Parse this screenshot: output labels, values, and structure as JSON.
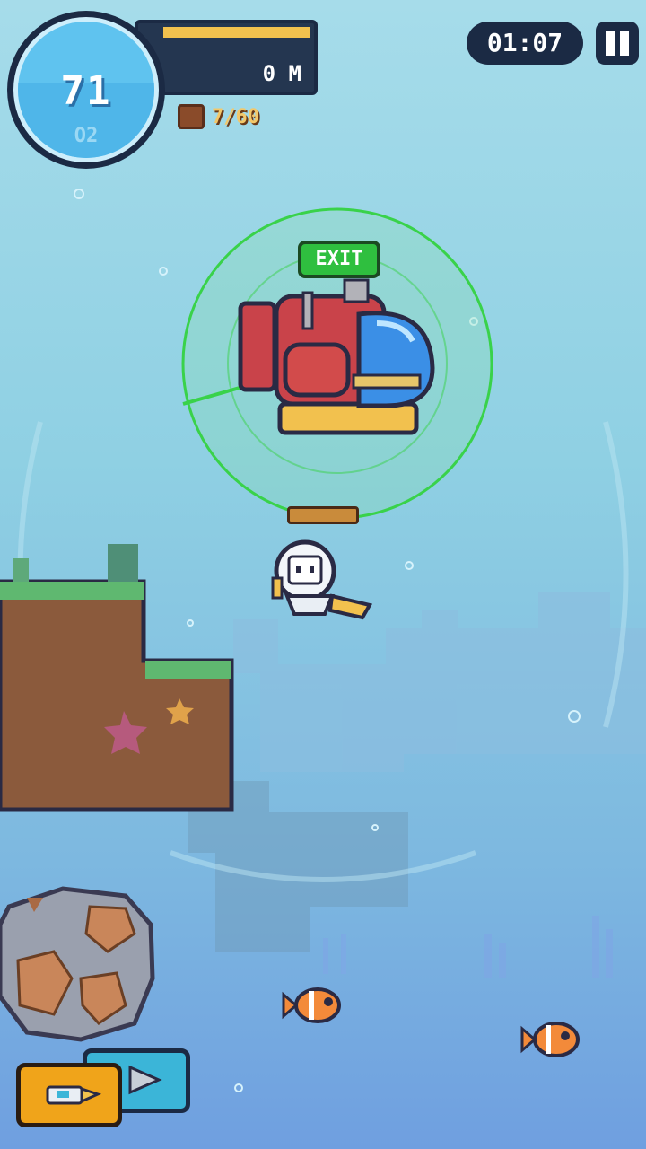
{
  "hud": {
    "oxygen_value": "71",
    "oxygen_label": "O2",
    "oxygen_level": 0.55,
    "depth": "0 M",
    "bag_count": "7/60",
    "timer": "01:07"
  },
  "submarine": {
    "exit_label": "EXIT"
  },
  "icons": {
    "pause": "pause-icon",
    "bag": "backpack-icon",
    "tool": "harpoon-gun-icon",
    "drill": "drill-icon"
  },
  "colors": {
    "water_top": "#a6dcea",
    "water_bottom": "#6f9fe0",
    "exit_green": "#2fbf3f",
    "range_ring": "#39d24a",
    "hud_dark": "#1b2a44"
  }
}
